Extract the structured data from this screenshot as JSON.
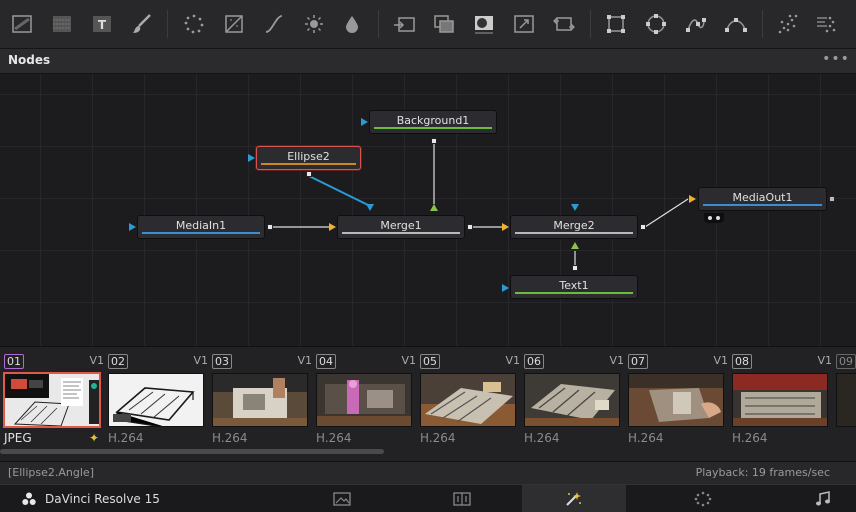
{
  "toolbar": {
    "tools": [
      {
        "name": "background-tool-icon"
      },
      {
        "name": "fast-noise-tool-icon"
      },
      {
        "name": "text-tool-icon"
      },
      {
        "name": "paint-tool-icon"
      },
      {
        "name": "particles-tool-icon"
      },
      {
        "name": "color-corrector-tool-icon"
      },
      {
        "name": "color-curves-tool-icon"
      },
      {
        "name": "brightness-contrast-tool-icon"
      },
      {
        "name": "blur-tool-icon"
      },
      {
        "name": "merge-tool-icon"
      },
      {
        "name": "channel-boolean-tool-icon"
      },
      {
        "name": "matte-control-tool-icon"
      },
      {
        "name": "resize-tool-icon"
      },
      {
        "name": "transform-tool-icon"
      },
      {
        "name": "rectangle-mask-icon"
      },
      {
        "name": "ellipse-mask-icon"
      },
      {
        "name": "polygon-mask-icon"
      },
      {
        "name": "bspline-mask-icon"
      },
      {
        "name": "particle-emitter-icon"
      },
      {
        "name": "particle-render-icon"
      }
    ]
  },
  "panel": {
    "title": "Nodes",
    "menu": "•••"
  },
  "nodes": [
    {
      "id": "background1",
      "label": "Background1",
      "bar_color": "#6dbb3a"
    },
    {
      "id": "ellipse2",
      "label": "Ellipse2",
      "bar_color": "#c98a1c"
    },
    {
      "id": "mediain1",
      "label": "MediaIn1",
      "bar_color": "#3a8fd4"
    },
    {
      "id": "merge1",
      "label": "Merge1",
      "bar_color": "#b9b9b9"
    },
    {
      "id": "merge2",
      "label": "Merge2",
      "bar_color": "#b9b9b9"
    },
    {
      "id": "mediaout1",
      "label": "MediaOut1",
      "bar_color": "#3a8fd4"
    },
    {
      "id": "text1",
      "label": "Text1",
      "bar_color": "#6dbb3a"
    }
  ],
  "clips": [
    {
      "num": "01",
      "track": "V1",
      "codec": "JPEG",
      "selected": true
    },
    {
      "num": "02",
      "track": "V1",
      "codec": "H.264"
    },
    {
      "num": "03",
      "track": "V1",
      "codec": "H.264"
    },
    {
      "num": "04",
      "track": "V1",
      "codec": "H.264"
    },
    {
      "num": "05",
      "track": "V1",
      "codec": "H.264"
    },
    {
      "num": "06",
      "track": "V1",
      "codec": "H.264"
    },
    {
      "num": "07",
      "track": "V1",
      "codec": "H.264"
    },
    {
      "num": "08",
      "track": "V1",
      "codec": "H.264"
    },
    {
      "num": "09",
      "track": "",
      "codec": ""
    }
  ],
  "status": {
    "left": "[Ellipse2.Angle]",
    "right": "Playback: 19 frames/sec"
  },
  "bottom": {
    "app_name": "DaVinci Resolve 15",
    "pages": [
      {
        "name": "media-page-icon"
      },
      {
        "name": "edit-page-icon"
      },
      {
        "name": "fusion-page-icon",
        "active": true
      },
      {
        "name": "color-page-icon"
      },
      {
        "name": "fairlight-page-icon"
      }
    ]
  },
  "colors": {
    "selected_node_border": "#d9534f",
    "wire_blue": "#2b9bd6",
    "input_orange": "#f0b030",
    "input_green": "#8bc34a"
  }
}
